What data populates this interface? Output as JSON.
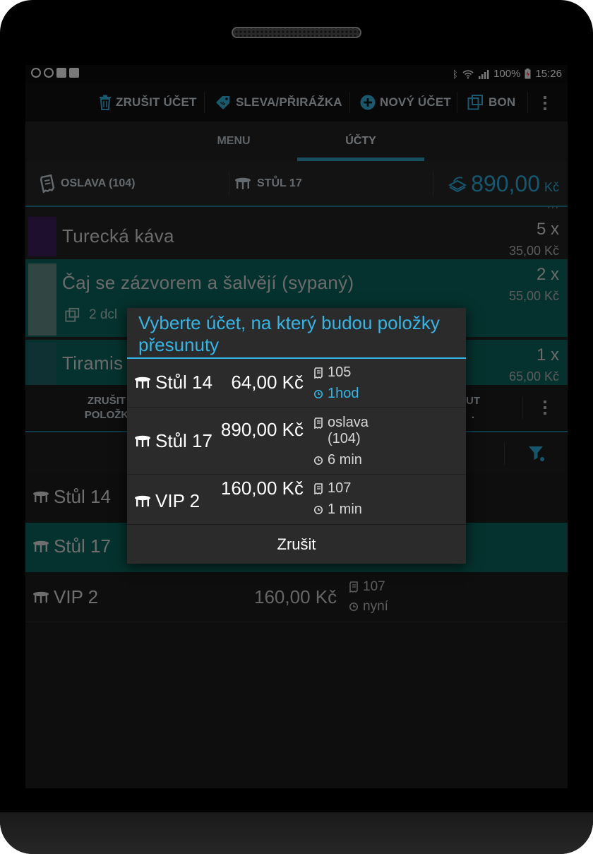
{
  "statusbar": {
    "battery": "100%",
    "time": "15:26"
  },
  "actionbar": {
    "cancel_bill": "ZRUŠIT ÚČET",
    "discount": "SLEVA/PŘIRÁŽKA",
    "new_bill": "NOVÝ ÚČET",
    "bon": "BON"
  },
  "tabs": [
    {
      "label": "MENU"
    },
    {
      "label": "ÚČTY"
    }
  ],
  "info": {
    "bill": "OSLAVA (104)",
    "table": "STŮL 17",
    "total": "890,00",
    "currency": "Kč"
  },
  "items": [
    {
      "name": "Turecká káva",
      "qty": "5 x",
      "price": "35,00 Kč",
      "color": "#3a1d55"
    },
    {
      "name": "Čaj se zázvorem a šalvějí (sypaný)",
      "qty": "2 x",
      "price": "55,00 Kč",
      "note": "2 dcl",
      "color": "#5a7f78"
    },
    {
      "name": "Tiramis",
      "qty": "1 x",
      "price": "65,00 Kč",
      "color": "#1d5a60"
    }
  ],
  "toolbar2": {
    "cancel_items_l1": "ZRUŠIT",
    "cancel_items_l2": "POLOŽK",
    "right_l1": "UT",
    "right_l2": "."
  },
  "accounts": [
    {
      "name": "Stůl 14"
    },
    {
      "name": "Stůl 17"
    },
    {
      "name": "VIP 2",
      "amount": "160,00 Kč",
      "bill": "107",
      "time": "nyní"
    }
  ],
  "dialog": {
    "title": "Vyberte účet, na který budou položky přesunuty",
    "rows": [
      {
        "table": "Stůl 14",
        "amount": "64,00 Kč",
        "bill": "105",
        "time": "1hod"
      },
      {
        "table": "Stůl 17",
        "amount": "890,00 Kč",
        "bill": "oslava (104)",
        "time": "6 min"
      },
      {
        "table": "VIP 2",
        "amount": "160,00 Kč",
        "bill": "107",
        "time": "1 min"
      }
    ],
    "cancel": "Zrušit"
  },
  "colors": {
    "accent": "#33b5e5",
    "selected_row": "#0a5b55",
    "total": "#2a9fc9"
  }
}
